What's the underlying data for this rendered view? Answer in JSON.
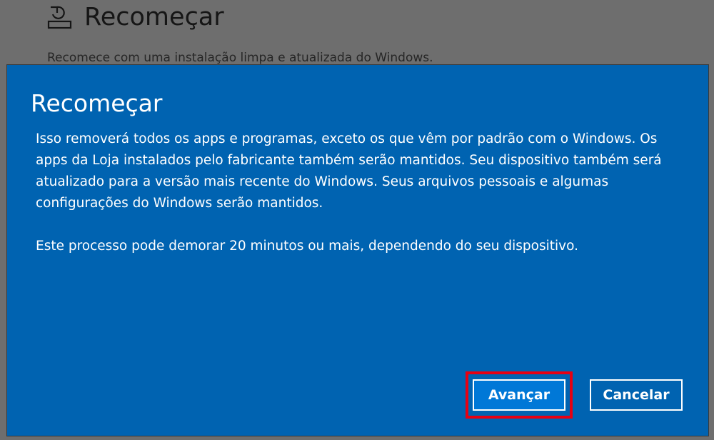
{
  "background": {
    "icon": "reset-pc-icon",
    "title": "Recomeçar",
    "subtitle": "Recomece com uma instalação limpa e atualizada do Windows."
  },
  "dialog": {
    "title": "Recomeçar",
    "paragraphs": [
      "Isso removerá todos os apps e programas, exceto os que vêm por padrão com o Windows. Os apps da Loja instalados pelo fabricante também serão mantidos. Seu dispositivo também será atualizado para a versão mais recente do Windows. Seus arquivos pessoais e algumas configurações do Windows serão mantidos.",
      "Este processo pode demorar 20 minutos ou mais, dependendo do seu dispositivo."
    ],
    "buttons": {
      "next_label": "Avançar",
      "cancel_label": "Cancelar"
    },
    "accent_color": "#0063b1",
    "highlight_color": "#e60012"
  }
}
